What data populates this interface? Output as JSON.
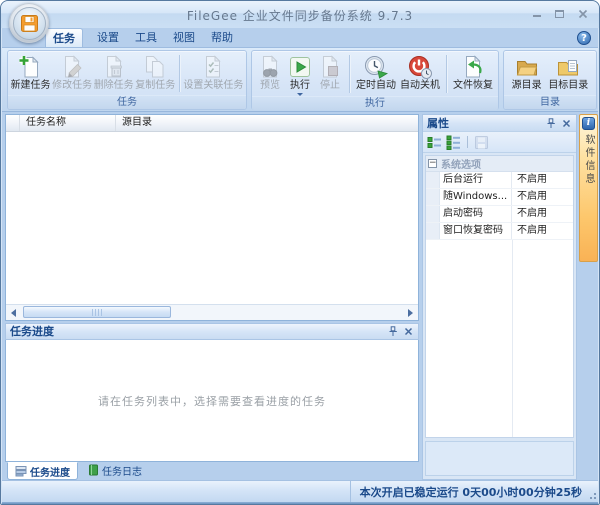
{
  "window": {
    "title": "FileGee 企业文件同步备份系统 9.7.3"
  },
  "colors": {
    "accent": "#1b4a8a",
    "titlebar_blue": "#cbdff4",
    "disabled_text": "#a0a7af",
    "run_green": "#3aa84a",
    "shutdown_red": "#d8473a",
    "folder_yellow": "#f4d183",
    "sidetab_orange": "#fdc76c"
  },
  "glyphs": {
    "help": "?",
    "info": "i",
    "collapse": "−"
  },
  "menu_tabs": {
    "items": [
      {
        "label": "任务",
        "active": true
      },
      {
        "label": "设置",
        "active": false
      },
      {
        "label": "工具",
        "active": false
      },
      {
        "label": "视图",
        "active": false
      },
      {
        "label": "帮助",
        "active": false
      }
    ]
  },
  "ribbon": {
    "groups": [
      {
        "label": "任务",
        "buttons": [
          {
            "label": "新建任务",
            "icon": "new-task-icon",
            "enabled": true
          },
          {
            "label": "修改任务",
            "icon": "edit-task-icon",
            "enabled": false
          },
          {
            "label": "删除任务",
            "icon": "delete-task-icon",
            "enabled": false
          },
          {
            "label": "复制任务",
            "icon": "copy-task-icon",
            "enabled": false
          },
          {
            "label": "设置关联任务",
            "icon": "related-task-icon",
            "enabled": false
          }
        ]
      },
      {
        "label": "执行",
        "buttons": [
          {
            "label": "预览",
            "icon": "preview-icon",
            "enabled": false
          },
          {
            "label": "执行",
            "icon": "run-icon",
            "enabled": true,
            "has_dropdown": true
          },
          {
            "label": "停止",
            "icon": "stop-icon",
            "enabled": false
          },
          {
            "label": "定时自动",
            "icon": "schedule-icon",
            "enabled": true
          },
          {
            "label": "自动关机",
            "icon": "auto-shutdown-icon",
            "enabled": true
          },
          {
            "label": "文件恢复",
            "icon": "file-restore-icon",
            "enabled": true
          }
        ]
      },
      {
        "label": "目录",
        "buttons": [
          {
            "label": "源目录",
            "icon": "source-folder-icon",
            "enabled": true
          },
          {
            "label": "目标目录",
            "icon": "target-folder-icon",
            "enabled": true
          }
        ]
      }
    ]
  },
  "task_list": {
    "columns": [
      {
        "label": "任务名称"
      },
      {
        "label": "源目录"
      }
    ],
    "rows": []
  },
  "progress_panel": {
    "title": "任务进度",
    "empty_message": "请在任务列表中，选择需要查看进度的任务",
    "tabs": [
      {
        "label": "任务进度",
        "active": true
      },
      {
        "label": "任务日志",
        "active": false
      }
    ]
  },
  "properties_panel": {
    "title": "属性",
    "group_header": "系统选项",
    "rows": [
      {
        "name": "后台运行",
        "value": "不启用"
      },
      {
        "name": "随Windows...",
        "value": "不启用"
      },
      {
        "name": "启动密码",
        "value": "不启用"
      },
      {
        "name": "窗口恢复密码",
        "value": "不启用"
      }
    ]
  },
  "side_tab": {
    "label": "软件信息"
  },
  "status_bar": {
    "uptime_text": "本次开启已稳定运行  0天00小时00分钟25秒"
  }
}
